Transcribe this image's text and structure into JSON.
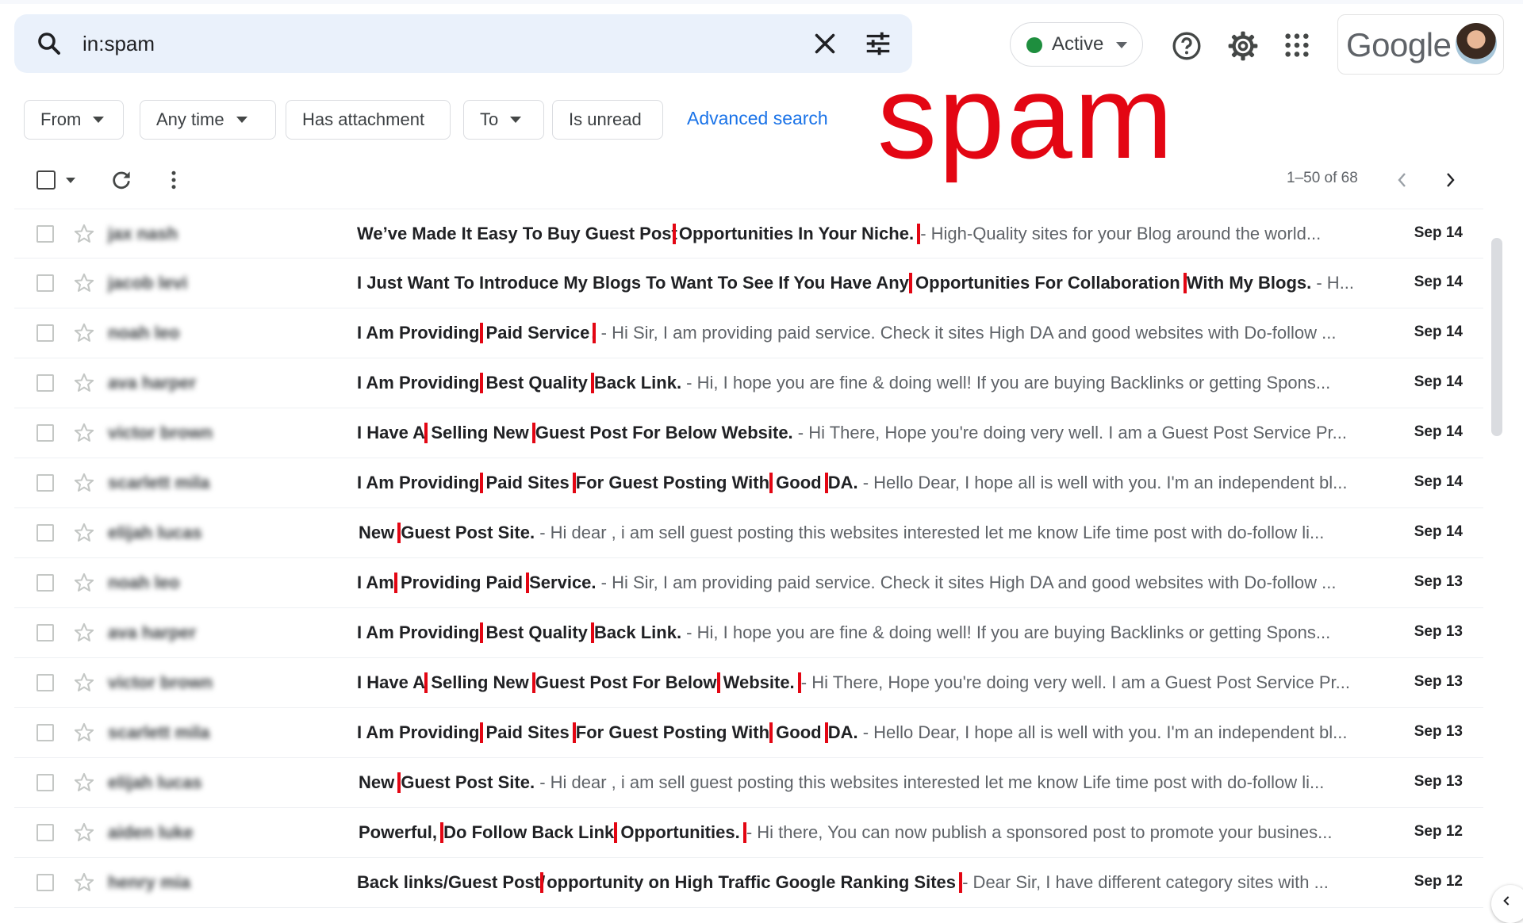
{
  "search": {
    "query": "in:spam",
    "status_label": "Active",
    "status_color": "#1e8e3e"
  },
  "brand": {
    "logo_text": "Google"
  },
  "filters": [
    {
      "label": "From",
      "has_caret": true
    },
    {
      "label": "Any time",
      "has_caret": true
    },
    {
      "label": "Has attachment",
      "has_caret": false
    },
    {
      "label": "To",
      "has_caret": true
    },
    {
      "label": "Is unread",
      "has_caret": false
    }
  ],
  "advanced_search_label": "Advanced search",
  "overlay_text": "spam",
  "overlay_color": "#e30613",
  "pagination": {
    "label": "1–50 of 68"
  },
  "messages": [
    {
      "sender": "jax nash",
      "date": "Sep 14",
      "subject": [
        {
          "t": "We’ve Made It Easy To Buy Guest Post"
        },
        {
          "t": "Opportunities In Your Niche.",
          "hl": true
        }
      ],
      "snippet": " - High-Quality sites for your Blog around the world..."
    },
    {
      "sender": "jacob levi",
      "date": "Sep 14",
      "subject": [
        {
          "t": "I Just Want To Introduce My Blogs To Want To See If You Have Any "
        },
        {
          "t": "Opportunities For Collaboration",
          "hl": true
        },
        {
          "t": " With My Blogs."
        }
      ],
      "snippet": " - H..."
    },
    {
      "sender": "noah leo",
      "date": "Sep 14",
      "subject": [
        {
          "t": "I Am Providing "
        },
        {
          "t": "Paid Service",
          "hl": true
        },
        {
          "t": "."
        }
      ],
      "snippet": " - Hi Sir, I am providing paid service. Check it sites High DA and good websites with Do-follow ..."
    },
    {
      "sender": "ava harper",
      "date": "Sep 14",
      "subject": [
        {
          "t": "I Am Providing "
        },
        {
          "t": "Best Quality",
          "hl": true
        },
        {
          "t": " Back Link."
        }
      ],
      "snippet": " - Hi, I hope you are fine & doing well! If you are buying Backlinks or getting Spons..."
    },
    {
      "sender": "victor brown",
      "date": "Sep 14",
      "subject": [
        {
          "t": "I Have A "
        },
        {
          "t": "Selling New",
          "hl": true
        },
        {
          "t": " Guest Post For Below Website."
        }
      ],
      "snippet": " - Hi There, Hope you're doing very well. I am a Guest Post Service Pr..."
    },
    {
      "sender": "scarlett mila",
      "date": "Sep 14",
      "subject": [
        {
          "t": "I Am Providing "
        },
        {
          "t": "Paid Sites",
          "hl": true
        },
        {
          "t": " For Guest Posting With "
        },
        {
          "t": "Good",
          "hl": true
        },
        {
          "t": " DA."
        }
      ],
      "snippet": " - Hello Dear, I hope all is well with you. I'm an independent bl..."
    },
    {
      "sender": "elijah lucas",
      "date": "Sep 14",
      "subject": [
        {
          "t": "New",
          "hl": true
        },
        {
          "t": " Guest Post Site."
        }
      ],
      "snippet": " - Hi dear , i am sell guest posting this websites interested let me know Life time post with do-follow li..."
    },
    {
      "sender": "noah leo",
      "date": "Sep 13",
      "subject": [
        {
          "t": "I Am "
        },
        {
          "t": "Providing Paid",
          "hl": true
        },
        {
          "t": " Service."
        }
      ],
      "snippet": " - Hi Sir, I am providing paid service. Check it sites High DA and good websites with Do-follow ..."
    },
    {
      "sender": "ava harper",
      "date": "Sep 13",
      "subject": [
        {
          "t": "I Am Providing "
        },
        {
          "t": "Best Quality",
          "hl": true
        },
        {
          "t": " Back Link."
        }
      ],
      "snippet": " - Hi, I hope you are fine & doing well! If you are buying Backlinks or getting Spons..."
    },
    {
      "sender": "victor brown",
      "date": "Sep 13",
      "subject": [
        {
          "t": "I Have A "
        },
        {
          "t": "Selling New",
          "hl": true
        },
        {
          "t": " Guest Post For Below "
        },
        {
          "t": "Website.",
          "hl": true
        }
      ],
      "snippet": " - Hi There, Hope you're doing very well. I am a Guest Post Service Pr..."
    },
    {
      "sender": "scarlett mila",
      "date": "Sep 13",
      "subject": [
        {
          "t": "I Am Providing "
        },
        {
          "t": "Paid Sites",
          "hl": true
        },
        {
          "t": " For Guest Posting With "
        },
        {
          "t": "Good",
          "hl": true
        },
        {
          "t": " DA."
        }
      ],
      "snippet": " - Hello Dear, I hope all is well with you. I'm an independent bl..."
    },
    {
      "sender": "elijah lucas",
      "date": "Sep 13",
      "subject": [
        {
          "t": "New",
          "hl": true
        },
        {
          "t": " Guest Post Site."
        }
      ],
      "snippet": " - Hi dear , i am sell guest posting this websites interested let me know Life time post with do-follow li..."
    },
    {
      "sender": "aiden luke",
      "date": "Sep 12",
      "subject": [
        {
          "t": "Powerful,",
          "hl": true
        },
        {
          "t": " Do Follow Back Link "
        },
        {
          "t": "Opportunities.",
          "hl": true
        }
      ],
      "snippet": " - Hi there, You can now publish a sponsored post to promote your busines..."
    },
    {
      "sender": "henry mia",
      "date": "Sep 12",
      "subject": [
        {
          "t": "Back links/Guest Post/"
        },
        {
          "t": "opportunity on High Traffic Google Ranking Sites",
          "hl": true
        }
      ],
      "snippet": " - Dear Sir, I have different category sites with ..."
    }
  ]
}
